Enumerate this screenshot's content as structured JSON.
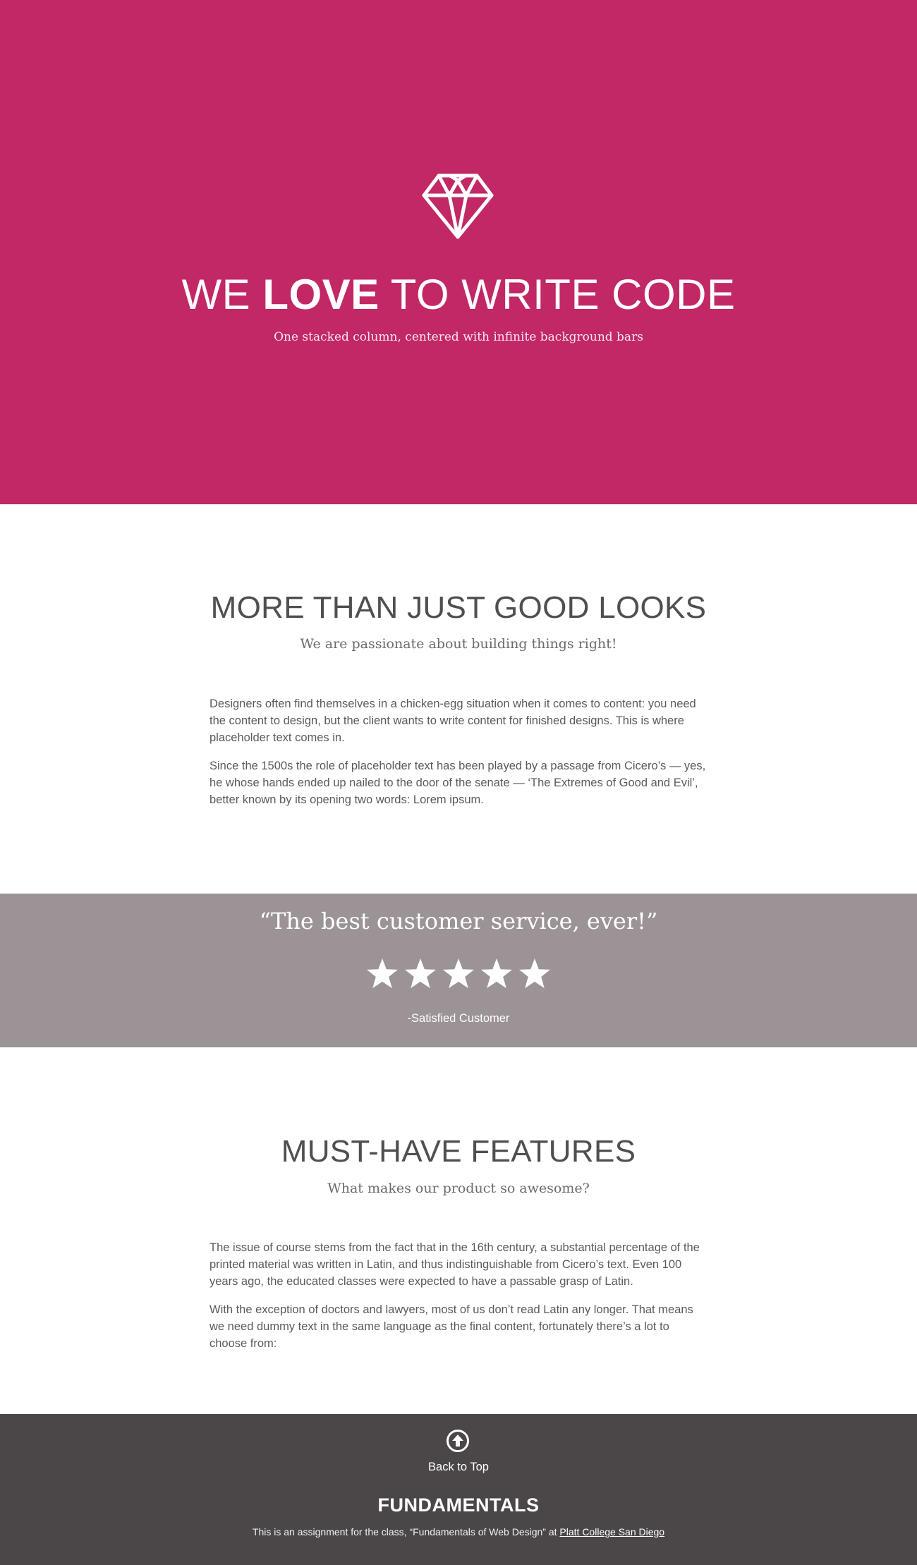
{
  "hero": {
    "title_pre": "WE ",
    "title_bold": "LOVE",
    "title_post": " TO WRITE CODE",
    "subtitle": "One stacked column, centered with infinite background bars",
    "icon": "diamond-icon",
    "background_color": "#c12865"
  },
  "section1": {
    "heading": "MORE THAN JUST GOOD LOOKS",
    "tagline": "We are passionate about building things right!",
    "paragraphs": [
      "Designers often find themselves in a chicken-egg situation when it comes to content: you need the content to design, but the client wants to write content for finished designs. This is where placeholder text comes in.",
      "Since the 1500s the role of placeholder text has been played by a passage from Cicero’s — yes, he whose hands ended up nailed to the door of the senate — ‘The Extremes of Good and Evil’, better known by its opening two words: Lorem ipsum."
    ]
  },
  "testimonial": {
    "quote": "“The best customer service, ever!”",
    "rating": 5,
    "rating_max": 5,
    "author": "-Satisfied Customer",
    "background_color": "#9c9396"
  },
  "section2": {
    "heading": "MUST-HAVE FEATURES",
    "tagline": "What makes our product so awesome?",
    "paragraphs": [
      "The issue of course stems from the fact that in the 16th century, a substantial percentage of the printed material was written in Latin, and thus indistinguishable from Cicero’s text. Even 100 years ago, the educated classes were expected to have a passable grasp of Latin.",
      "With the exception of doctors and lawyers, most of us don’t read Latin any longer. That means we need dummy text in the same language as the final content, fortunately there’s a lot to choose from:"
    ]
  },
  "footer": {
    "back_to_top": "Back to Top",
    "back_icon": "arrow-up-circle-icon",
    "brand": "FUNDAMENTALS",
    "note_prefix": "This is an assignment for the class, “Fundamentals of Web Design” at ",
    "note_link": "Platt College San Diego",
    "background_color": "#4b4748"
  }
}
